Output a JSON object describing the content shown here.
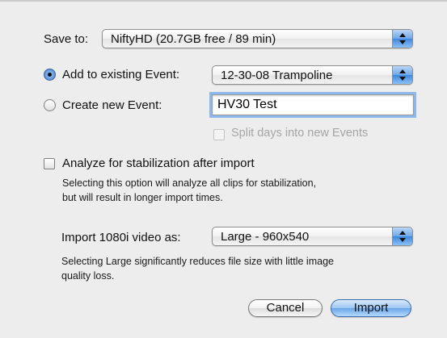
{
  "save_to": {
    "label": "Save to:",
    "value": "NiftyHD (20.7GB free / 89 min)"
  },
  "event": {
    "add_existing_label": "Add to existing Event:",
    "existing_value": "12-30-08 Trampoline",
    "create_new_label": "Create new Event:",
    "new_event_name": "HV30 Test",
    "split_days_label": "Split days into new Events"
  },
  "stabilization": {
    "label": "Analyze for stabilization after import",
    "help_line1": "Selecting this option will analyze all clips for stabilization,",
    "help_line2": "but will result in longer import times."
  },
  "import_size": {
    "label": "Import 1080i video as:",
    "value": "Large - 960x540",
    "help_line1": "Selecting Large significantly reduces file size with little image",
    "help_line2": "quality loss."
  },
  "buttons": {
    "cancel": "Cancel",
    "import": "Import"
  },
  "icons": {
    "popup_arrows": "up-down-arrows-icon"
  },
  "colors": {
    "accent": "#4a8ae0",
    "background": "#ededed"
  }
}
